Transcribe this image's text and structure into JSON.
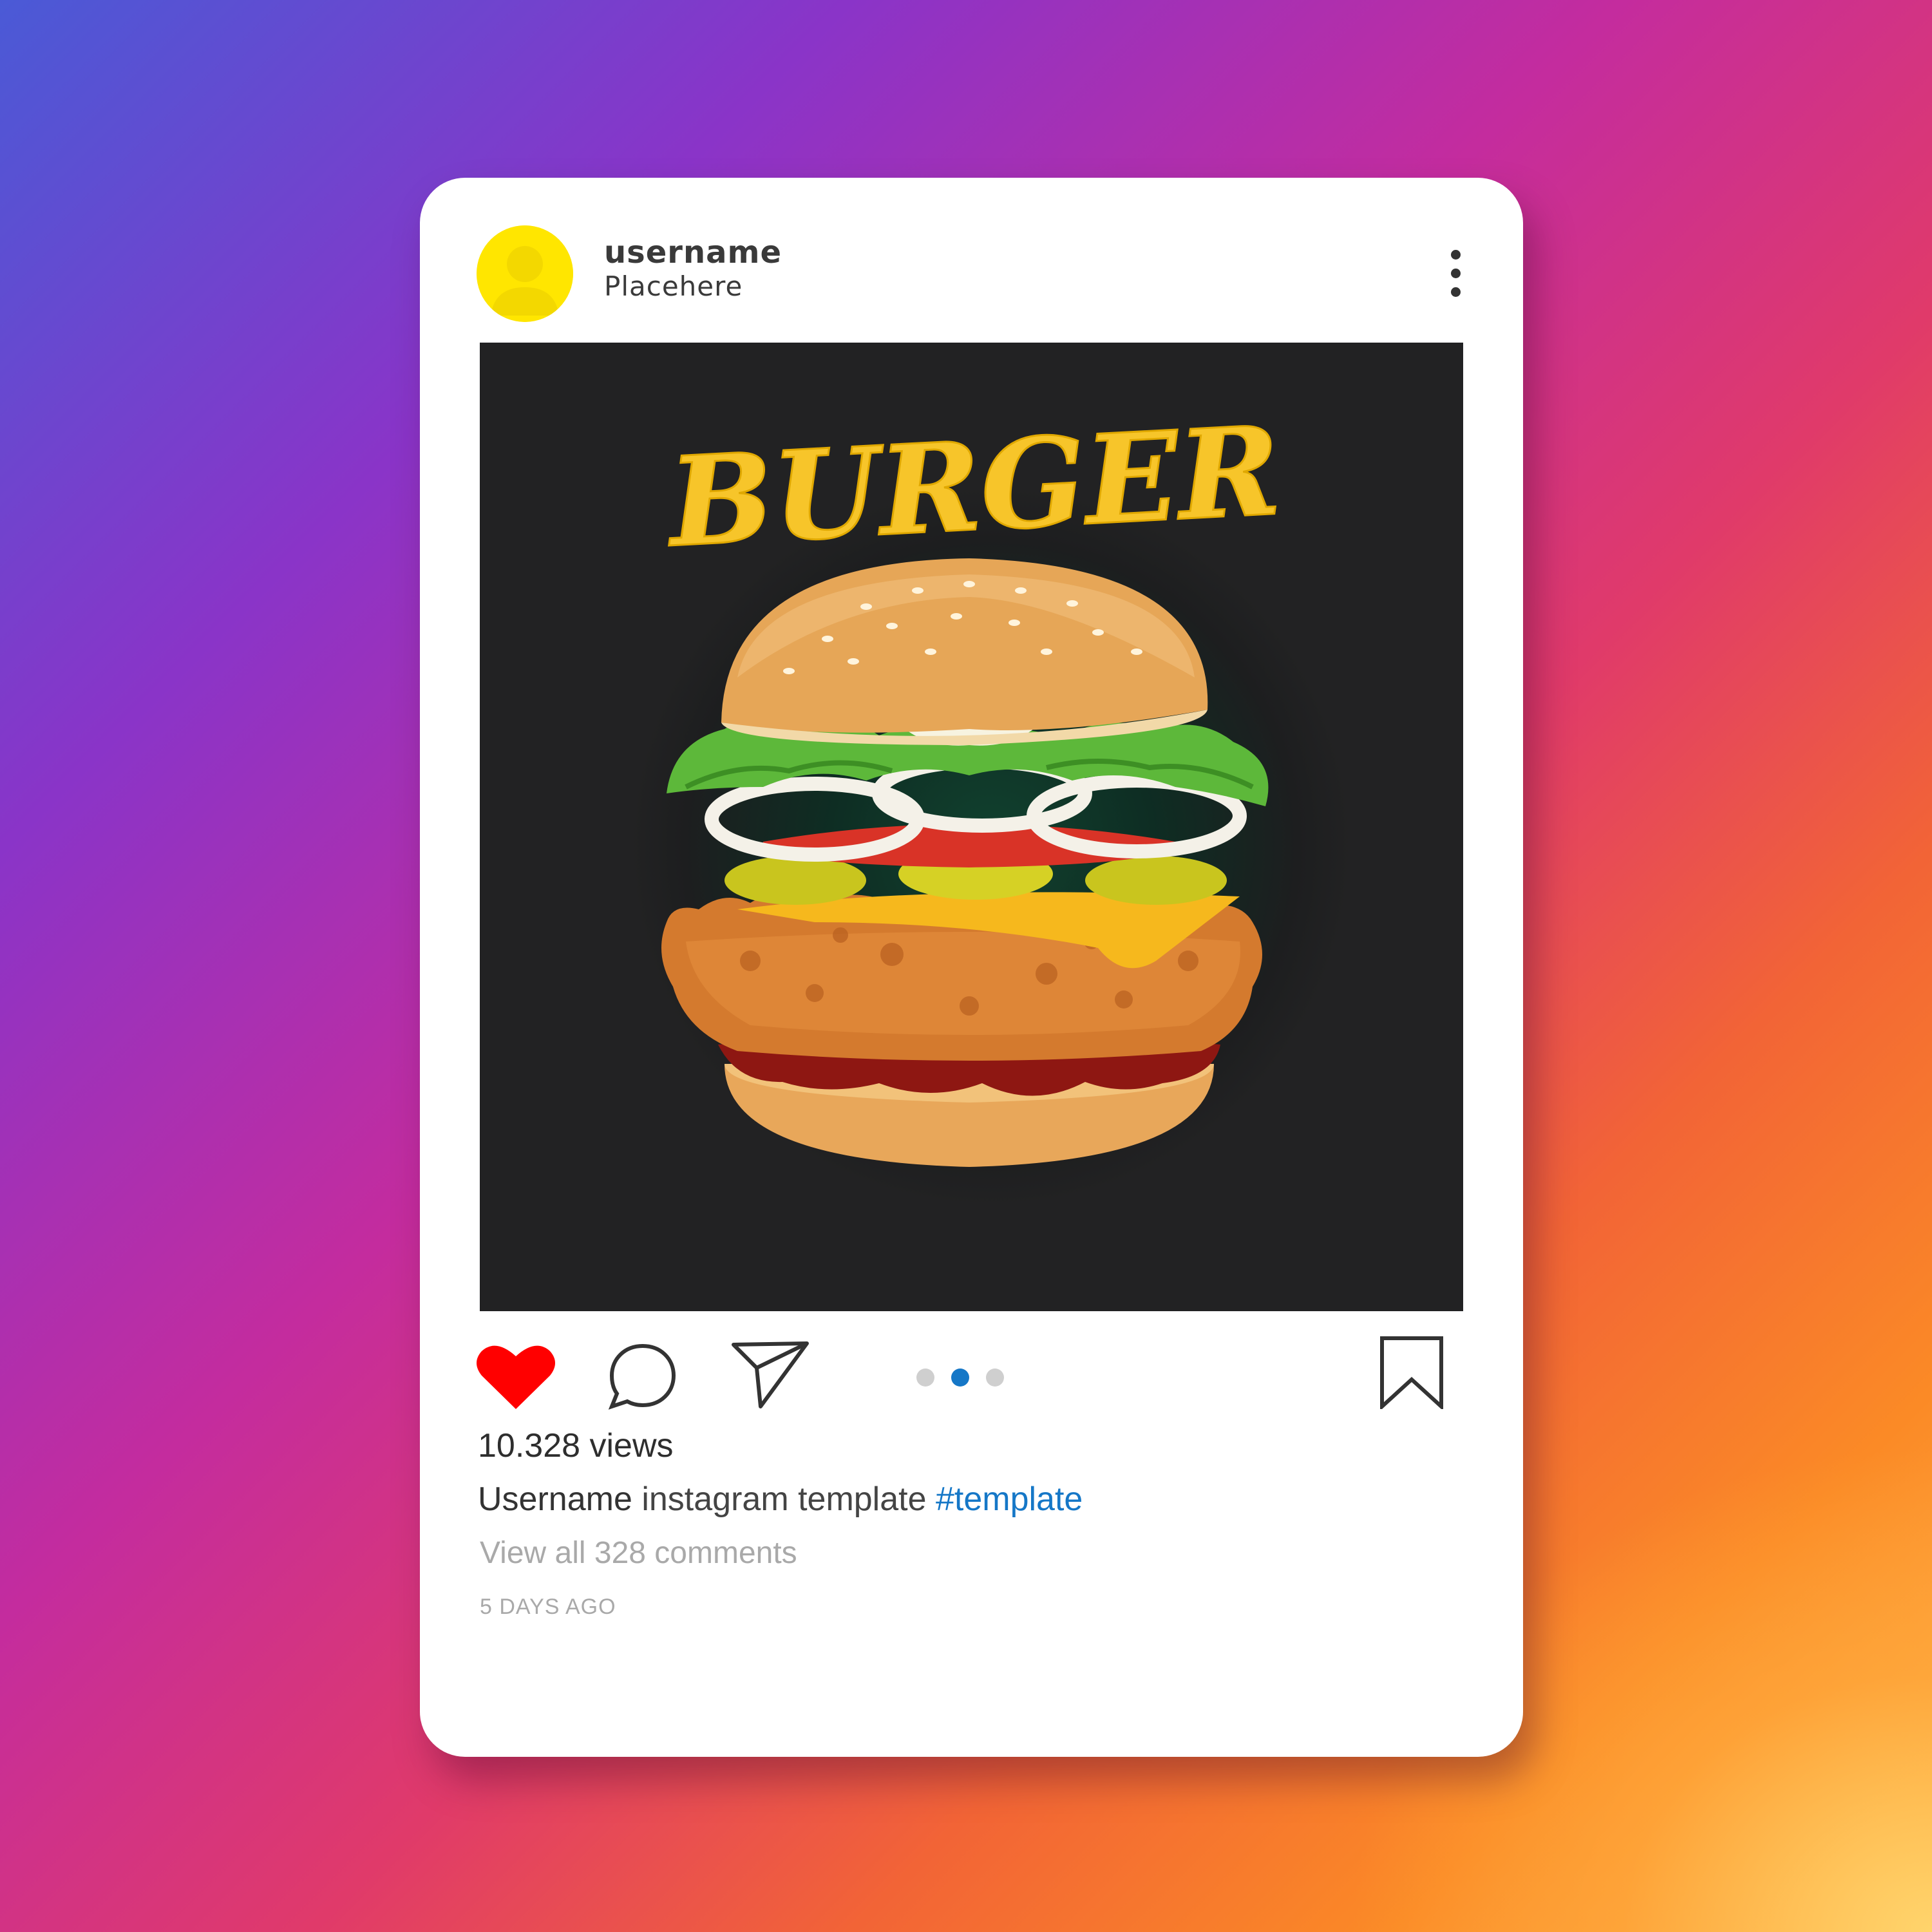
{
  "post": {
    "username": "username",
    "place": "Placehere",
    "image_title": "BURGER",
    "views": "10.328 views",
    "caption_user": "Username",
    "caption_text": " instagram template ",
    "caption_tag": "#template",
    "comments_link": "View all 328 comments",
    "time_ago": "5 DAYS AGO",
    "carousel": {
      "count": 3,
      "active_index": 1
    },
    "liked": true
  },
  "colors": {
    "avatar": "#ffe600",
    "heart": "#ff0000",
    "hashtag": "#1577c7",
    "dot_active": "#1577c7",
    "dot_inactive": "#cfcfcf",
    "burger_title": "#f7c52a"
  },
  "icons": [
    "avatar-user-icon",
    "more-options-icon",
    "heart-icon",
    "comment-icon",
    "share-icon",
    "bookmark-icon"
  ]
}
